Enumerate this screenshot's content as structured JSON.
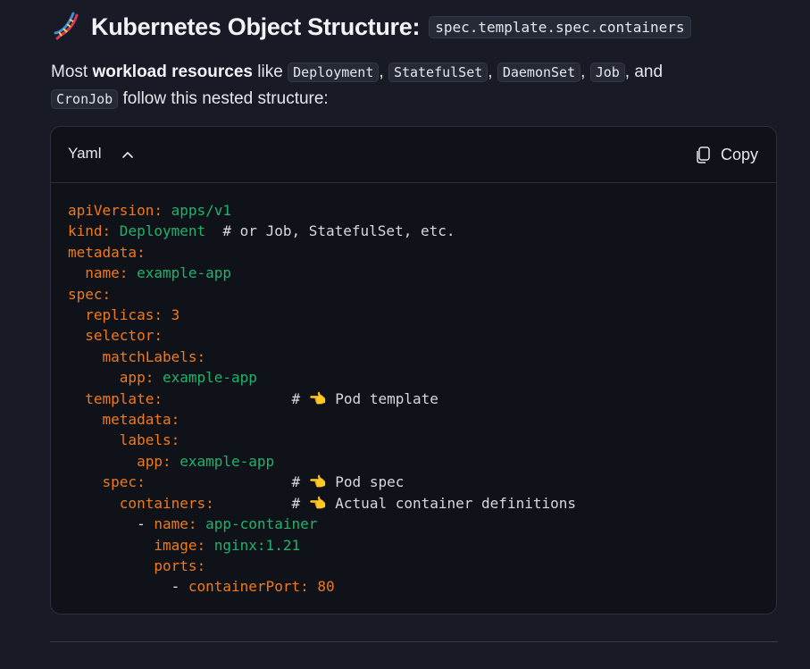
{
  "heading": {
    "icon": "dna-icon",
    "title": "Kubernetes Object Structure:",
    "code": "spec.template.spec.containers"
  },
  "intro": {
    "part1": "Most ",
    "bold": "workload resources",
    "part2": " like ",
    "resources": [
      "Deployment",
      "StatefulSet",
      "DaemonSet",
      "Job",
      "CronJob"
    ],
    "sep1": ", ",
    "sep2": ", ",
    "sep3": ", ",
    "and": ", and",
    "part3": " follow this nested structure:"
  },
  "codeblock": {
    "language": "Yaml",
    "copy_label": "Copy",
    "lines": [
      [
        {
          "t": "apiVersion:",
          "c": "k"
        },
        {
          "t": " apps/v1",
          "c": "v"
        }
      ],
      [
        {
          "t": "kind:",
          "c": "k"
        },
        {
          "t": " Deployment",
          "c": "v"
        },
        {
          "t": "  # or Job, StatefulSet, etc.",
          "c": "c"
        }
      ],
      [
        {
          "t": "metadata:",
          "c": "k"
        }
      ],
      [
        {
          "t": "  name:",
          "c": "k"
        },
        {
          "t": " example-app",
          "c": "v"
        }
      ],
      [
        {
          "t": "spec:",
          "c": "k"
        }
      ],
      [
        {
          "t": "  replicas:",
          "c": "k"
        },
        {
          "t": " 3",
          "c": "n"
        }
      ],
      [
        {
          "t": "  selector:",
          "c": "k"
        }
      ],
      [
        {
          "t": "    matchLabels:",
          "c": "k"
        }
      ],
      [
        {
          "t": "      app:",
          "c": "k"
        },
        {
          "t": " example-app",
          "c": "v"
        }
      ],
      [
        {
          "t": "  template:",
          "c": "k"
        },
        {
          "t": "               # 👈 Pod template",
          "c": "c"
        }
      ],
      [
        {
          "t": "    metadata:",
          "c": "k"
        }
      ],
      [
        {
          "t": "      labels:",
          "c": "k"
        }
      ],
      [
        {
          "t": "        app:",
          "c": "k"
        },
        {
          "t": " example-app",
          "c": "v"
        }
      ],
      [
        {
          "t": "    spec:",
          "c": "k"
        },
        {
          "t": "                 # 👈 Pod spec",
          "c": "c"
        }
      ],
      [
        {
          "t": "      containers:",
          "c": "k"
        },
        {
          "t": "         # 👈 Actual container definitions",
          "c": "c"
        }
      ],
      [
        {
          "t": "        - ",
          "c": "d"
        },
        {
          "t": "name:",
          "c": "k"
        },
        {
          "t": " app-container",
          "c": "v"
        }
      ],
      [
        {
          "t": "          image:",
          "c": "k"
        },
        {
          "t": " nginx:1.21",
          "c": "v"
        }
      ],
      [
        {
          "t": "          ports:",
          "c": "k"
        }
      ],
      [
        {
          "t": "            - ",
          "c": "d"
        },
        {
          "t": "containerPort:",
          "c": "k"
        },
        {
          "t": " 80",
          "c": "n"
        }
      ]
    ]
  },
  "colors": {
    "background": "#181b25",
    "code_background": "#101219",
    "key": "#f07a1a",
    "string": "#1fb36b",
    "comment": "#d7d8dc"
  }
}
